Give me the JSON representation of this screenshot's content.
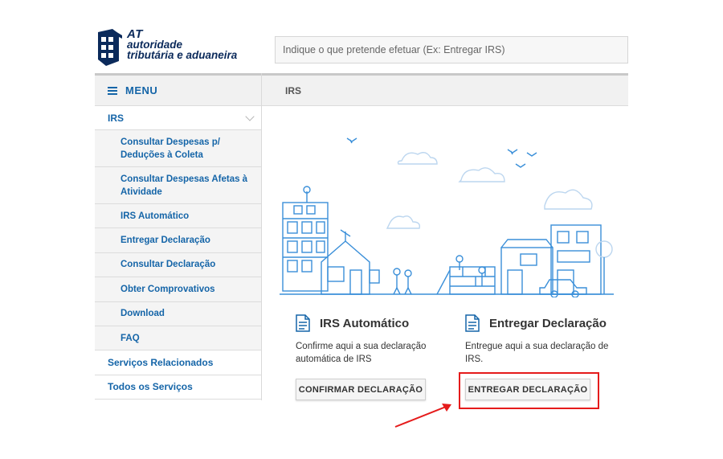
{
  "header": {
    "logo_at": "AT",
    "logo_line1": "autoridade",
    "logo_line2": "tributária e aduaneira",
    "search_placeholder": "Indique o que pretende efetuar (Ex: Entregar IRS)"
  },
  "sidebar": {
    "menu_label": "MENU",
    "top_item": "IRS",
    "sub_items": [
      "Consultar Despesas p/ Deduções à Coleta",
      "Consultar Despesas Afetas à Atividade",
      "IRS Automático",
      "Entregar Declaração",
      "Consultar Declaração",
      "Obter Comprovativos",
      "Download",
      "FAQ"
    ],
    "bottom_items": [
      "Serviços Relacionados",
      "Todos os Serviços"
    ]
  },
  "main": {
    "breadcrumb": "IRS",
    "cards": [
      {
        "title": "IRS Automático",
        "desc_line1": "Confirme aqui a sua declaração",
        "desc_line2": "automática de IRS",
        "button": "CONFIRMAR DECLARAÇÃO"
      },
      {
        "title": "Entregar Declaração",
        "desc_line1": "Entregue aqui a sua declaração de",
        "desc_line2": "IRS.",
        "button": "ENTREGAR DECLARAÇÃO"
      }
    ]
  },
  "colors": {
    "brand_blue": "#1565a8",
    "logo_navy": "#0b2a5b",
    "illustration_blue": "#3a8fd9",
    "highlight_red": "#e51b1b"
  }
}
